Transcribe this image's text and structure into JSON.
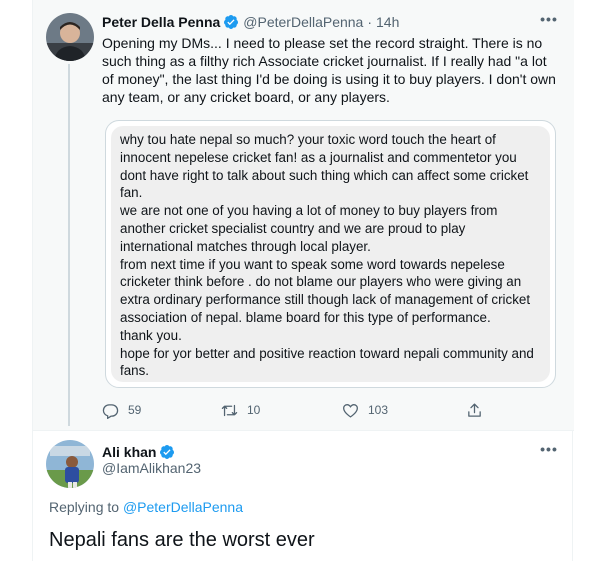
{
  "colors": {
    "accent": "#1d9bf0",
    "secondary_text": "#536471",
    "primary_text": "#0f1419",
    "dm_bubble_bg": "#efefef",
    "thread_bg": "#f7f9f9"
  },
  "tweet1": {
    "display_name": "Peter Della Penna",
    "handle": "@PeterDellaPenna",
    "separator": "·",
    "time": "14h",
    "more_label": "•••",
    "text": "Opening my DMs... I need to please set the record straight. There is no such thing as a filthy rich Associate cricket journalist. If I really had \"a lot of money\", the last thing I'd be doing is using it to buy players. I don't own any team, or any cricket board, or any players.",
    "dm_lines": [
      "why tou hate nepal so much? your toxic word touch the heart of",
      "innocent nepelese cricket fan! as a journalist and commentetor you",
      "dont have right to talk about such thing which can affect some cricket",
      "fan.",
      "we are not one of you having a lot of money to buy players from",
      "another cricket specialist country and we are proud to play",
      "international matches through local player.",
      "from next time if you want to speak some word towards nepelese",
      "cricketer think before . do not blame our players who were giving an",
      "extra ordinary performance still though lack of management of cricket",
      "association of nepal. blame board for this type of performance.",
      "thank you.",
      "hope for yor better and positive reaction toward nepali community and",
      "fans."
    ],
    "actions": {
      "replies": "59",
      "retweets": "10",
      "likes": "103"
    }
  },
  "tweet2": {
    "display_name": "Ali khan",
    "handle": "@IamAlikhan23",
    "more_label": "•••",
    "replying_prefix": "Replying to",
    "replying_to": "@PeterDellaPenna",
    "text": "Nepali fans are the worst ever"
  }
}
